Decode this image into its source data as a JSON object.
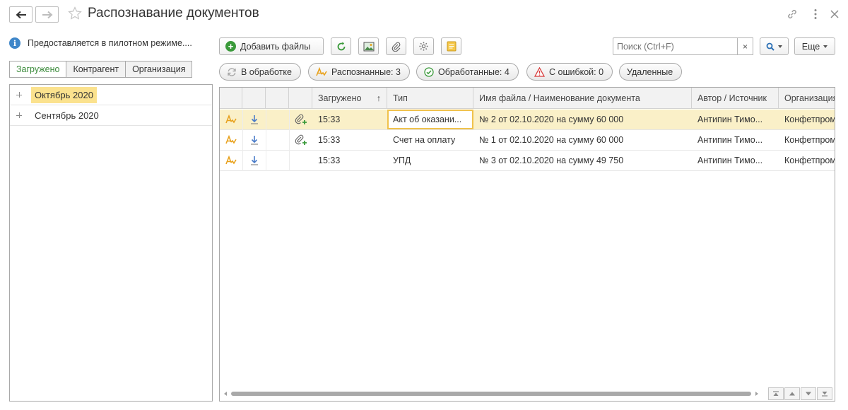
{
  "header": {
    "title": "Распознавание документов"
  },
  "left_panel": {
    "info_text": "Предоставляется в пилотном режиме....",
    "tabs": [
      {
        "label": "Загружено",
        "active": true
      },
      {
        "label": "Контрагент",
        "active": false
      },
      {
        "label": "Организация",
        "active": false
      }
    ],
    "tree": [
      {
        "label": "Октябрь 2020",
        "selected": true
      },
      {
        "label": "Сентябрь 2020",
        "selected": false
      }
    ]
  },
  "toolbar": {
    "add_files_label": "Добавить файлы",
    "icons": [
      "refresh-icon",
      "image-icon",
      "paperclip-icon",
      "settings-icon",
      "note-icon"
    ],
    "search_placeholder": "Поиск (Ctrl+F)",
    "clear_symbol": "×",
    "more_label": "Еще"
  },
  "filters": [
    {
      "label": "В обработке",
      "icon": "processing-icon"
    },
    {
      "label": "Распознанные: 3",
      "icon": "recognized-icon"
    },
    {
      "label": "Обработанные: 4",
      "icon": "check-icon"
    },
    {
      "label": "С ошибкой: 0",
      "icon": "warning-icon"
    },
    {
      "label": "Удаленные",
      "icon": ""
    }
  ],
  "table": {
    "columns": [
      "Загружено",
      "Тип",
      "Имя файла / Наименование документа",
      "Автор / Источник",
      "Организация"
    ],
    "sort_indicator": "↑",
    "rows": [
      {
        "time": "15:33",
        "type": "Акт об оказани...",
        "name": "№ 2 от 02.10.2020 на сумму 60 000",
        "author": "Антипин Тимо...",
        "org": "Конфетпром",
        "attach": true,
        "selected": true
      },
      {
        "time": "15:33",
        "type": "Счет на оплату",
        "name": "№ 1 от 02.10.2020 на сумму 60 000",
        "author": "Антипин Тимо...",
        "org": "Конфетпром",
        "attach": true,
        "selected": false
      },
      {
        "time": "15:33",
        "type": "УПД",
        "name": "№ 3 от 02.10.2020 на сумму 49 750",
        "author": "Антипин Тимо...",
        "org": "Конфетпром",
        "attach": false,
        "selected": false
      }
    ]
  },
  "colors": {
    "accent_green": "#3a9a3a",
    "selection": "#fbe28e",
    "info_blue": "#3e86c9",
    "recognized_orange": "#e8a21e"
  }
}
